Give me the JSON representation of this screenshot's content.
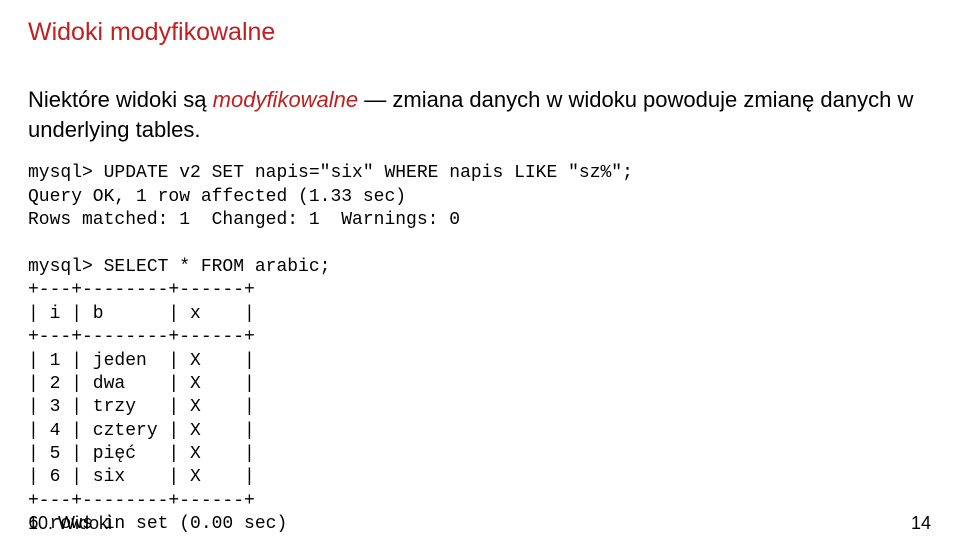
{
  "title": "Widoki modyfikowalne",
  "paragraph": {
    "part1": "Niektóre widoki są ",
    "em": "modyfikowalne",
    "part2": " — zmiana danych w widoku powoduje zmianę danych w underlying tables."
  },
  "code": "mysql> UPDATE v2 SET napis=\"six\" WHERE napis LIKE \"sz%\";\nQuery OK, 1 row affected (1.33 sec)\nRows matched: 1  Changed: 1  Warnings: 0\n\nmysql> SELECT * FROM arabic;\n+---+--------+------+\n| i | b      | x    |\n+---+--------+------+\n| 1 | jeden  | X    |\n| 2 | dwa    | X    |\n| 3 | trzy   | X    |\n| 4 | cztery | X    |\n| 5 | pięć   | X    |\n| 6 | six    | X    |\n+---+--------+------+\n6 rows in set (0.00 sec)",
  "footer": {
    "left": "10. Widoki",
    "right": "14"
  }
}
